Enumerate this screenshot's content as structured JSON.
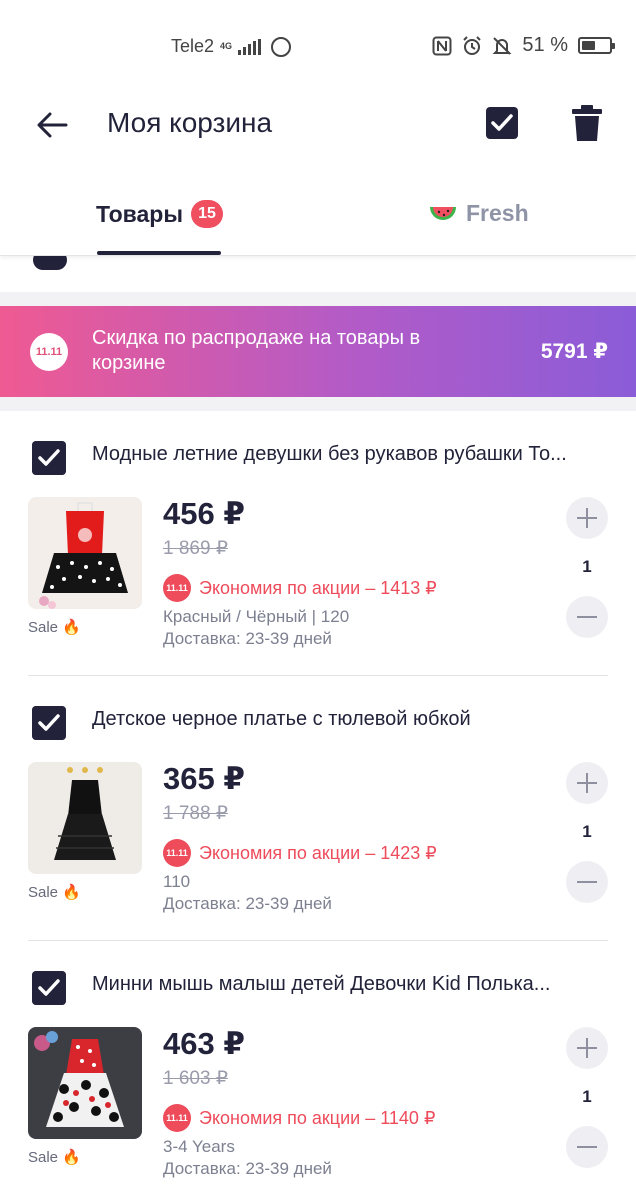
{
  "status_bar": {
    "carrier": "Tele2",
    "network": "4G",
    "battery": "51 %",
    "battery_level": 0.51,
    "icons": [
      "signal-icon",
      "whatsapp-icon",
      "nfc-icon",
      "alarm-icon",
      "mute-icon",
      "battery-icon"
    ]
  },
  "header": {
    "title": "Моя корзина",
    "icons": [
      "back-arrow-icon",
      "check-all-icon",
      "trash-icon"
    ]
  },
  "tabs": [
    {
      "label": "Товары",
      "badge": "15",
      "active": true
    },
    {
      "label": "Fresh",
      "icon": "watermelon-icon",
      "active": false
    }
  ],
  "promo": {
    "tag": "11.11",
    "text": "Скидка по распродаже на товары в корзине",
    "amount": "5791 ₽"
  },
  "items": [
    {
      "title": "Модные летние девушки без рукавов рубашки То...",
      "price": "456 ₽",
      "old_price": "1 869 ₽",
      "saving_tag": "11.11",
      "saving": "Экономия по акции – 1413 ₽",
      "variant": "Красный / Чёрный | 120",
      "delivery": "Доставка: 23-39 дней",
      "sale_label": "Sale 🔥",
      "qty": "1"
    },
    {
      "title": "Детское черное платье с тюлевой юбкой",
      "price": "365 ₽",
      "old_price": "1 788 ₽",
      "saving_tag": "11.11",
      "saving": "Экономия по акции – 1423 ₽",
      "variant": "110",
      "delivery": "Доставка: 23-39 дней",
      "sale_label": "Sale 🔥",
      "qty": "1"
    },
    {
      "title": "Минни мышь малыш детей Девочки Kid Полька...",
      "price": "463 ₽",
      "old_price": "1 603 ₽",
      "saving_tag": "11.11",
      "saving": "Экономия по акции – 1140 ₽",
      "variant": "3-4 Years",
      "delivery": "Доставка: 23-39 дней",
      "sale_label": "Sale 🔥",
      "qty": "1"
    }
  ]
}
